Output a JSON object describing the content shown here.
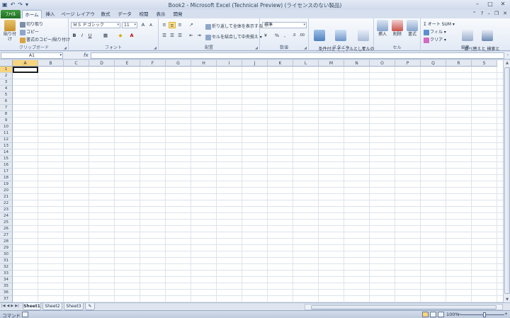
{
  "window": {
    "title": "Book2 - Microsoft Excel (Technical Preview) (ライセンスのない製品)"
  },
  "qat": {
    "save_icon": "floppy-disk-icon",
    "undo_icon": "undo-icon",
    "redo_icon": "redo-icon"
  },
  "ribbon_tabs": {
    "file": "ﾌｧｲﾙ",
    "items": [
      "ホーム",
      "挿入",
      "ページ レイアウト",
      "数式",
      "データ",
      "校閲",
      "表示",
      "開発"
    ],
    "active": "ホーム"
  },
  "clipboard": {
    "paste": "貼り付け",
    "cut": "切り取り",
    "copy": "コピー",
    "format_painter": "書式のコピー/貼り付け",
    "label": "クリップボード"
  },
  "font": {
    "name": "ＭＳ Ｐゴシック",
    "size": "11",
    "grow": "A",
    "shrink": "A",
    "bold": "B",
    "italic": "I",
    "underline": "U",
    "label": "フォント"
  },
  "alignment": {
    "wrap": "折り返して全体を表示する",
    "merge": "セルを結合して中央揃え",
    "label": "配置"
  },
  "number": {
    "format": "標準",
    "percent": "%",
    "comma": ",",
    "label": "数値"
  },
  "styles": {
    "conditional": "条件付き\n書式",
    "table": "テーブルとして\n書式設定",
    "cell": "セルの\nスタイル",
    "label": "スタイル"
  },
  "cells": {
    "insert": "挿入",
    "delete": "削除",
    "format": "書式",
    "label": "セル"
  },
  "editing": {
    "autosum": "オート SUM",
    "fill": "フィル",
    "clear": "クリア",
    "sort": "並べ替えと\nフィルター",
    "find": "検索と\n選択",
    "label": "編集"
  },
  "formula_bar": {
    "name_box": "A1",
    "fx": "fx",
    "formula": ""
  },
  "grid": {
    "columns": [
      "A",
      "B",
      "C",
      "D",
      "E",
      "F",
      "G",
      "H",
      "I",
      "J",
      "K",
      "L",
      "M",
      "N",
      "O",
      "P",
      "Q",
      "R",
      "S"
    ],
    "row_count": 37,
    "selected_cell": "A1"
  },
  "sheets": {
    "tabs": [
      "Sheet1",
      "Sheet2",
      "Sheet3"
    ],
    "active": "Sheet1"
  },
  "status": {
    "mode": "コマンド",
    "zoom": "100%"
  }
}
